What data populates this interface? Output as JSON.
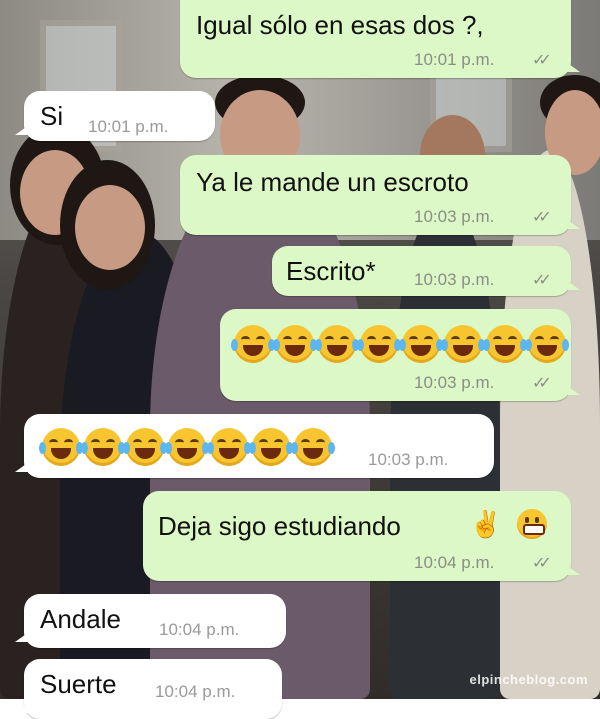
{
  "messages": [
    {
      "text": "Igual sólo en esas dos ?,",
      "time": "10:01 p.m.",
      "direction": "out",
      "read": true
    },
    {
      "text": "Si",
      "time": "10:01 p.m.",
      "direction": "in"
    },
    {
      "text": "Ya le mande un escroto",
      "time": "10:03 p.m.",
      "direction": "out",
      "read": true
    },
    {
      "text": "Escrito*",
      "time": "10:03 p.m.",
      "direction": "out",
      "read": true
    },
    {
      "emoji": "face-with-tears-of-joy",
      "count": 8,
      "time": "10:03 p.m.",
      "direction": "out",
      "read": true
    },
    {
      "emoji": "face-with-tears-of-joy",
      "count": 7,
      "time": "10:03 p.m.",
      "direction": "in"
    },
    {
      "text": "Deja sigo estudiando",
      "trailing_emojis": [
        "victory-hand",
        "grinning-face"
      ],
      "time": "10:04 p.m.",
      "direction": "out",
      "read": true
    },
    {
      "text": "Andale",
      "time": "10:04 p.m.",
      "direction": "in"
    },
    {
      "text": "Suerte",
      "time": "10:04 p.m.",
      "direction": "in"
    }
  ],
  "read_ticks": "✓✓",
  "watermark": "elpincheblog.com",
  "colors": {
    "outgoing_bubble": "#dcf8c6",
    "incoming_bubble": "#ffffff",
    "time_text": "#8a8f85"
  }
}
